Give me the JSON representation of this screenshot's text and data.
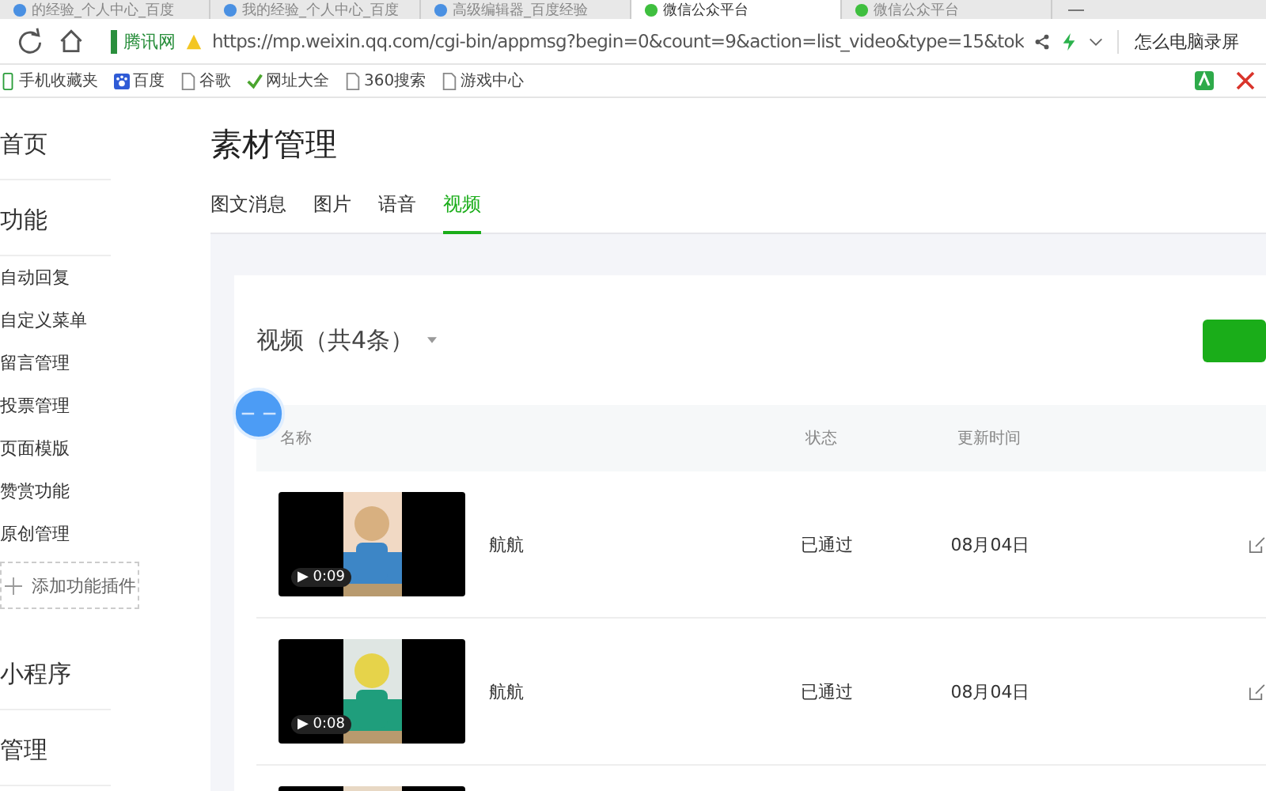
{
  "browser": {
    "tabs": [
      {
        "title": "的经验_个人中心_百度",
        "selected": false
      },
      {
        "title": "我的经验_个人中心_百度",
        "selected": false
      },
      {
        "title": "高级编辑器_百度经验",
        "selected": false
      },
      {
        "title": "微信公众平台",
        "selected": true
      },
      {
        "title": "微信公众平台",
        "selected": false
      }
    ],
    "site_badge": "腾讯网",
    "url": "https://mp.weixin.qq.com/cgi-bin/appmsg?begin=0&count=9&action=list_video&type=15&tok",
    "search": "怎么电脑录屏",
    "bookmarks": [
      {
        "label": "手机收藏夹",
        "kind": "phone"
      },
      {
        "label": "百度",
        "kind": "paw"
      },
      {
        "label": "谷歌",
        "kind": "page"
      },
      {
        "label": "网址大全",
        "kind": "check"
      },
      {
        "label": "360搜索",
        "kind": "page"
      },
      {
        "label": "游戏中心",
        "kind": "page"
      }
    ]
  },
  "sidebar": {
    "items": [
      {
        "label": "首页",
        "kind": "heading"
      },
      {
        "label": "功能",
        "kind": "heading"
      },
      {
        "label": "自动回复",
        "kind": "item"
      },
      {
        "label": "自定义菜单",
        "kind": "item"
      },
      {
        "label": "留言管理",
        "kind": "item"
      },
      {
        "label": "投票管理",
        "kind": "item"
      },
      {
        "label": "页面模版",
        "kind": "item"
      },
      {
        "label": "赞赏功能",
        "kind": "item"
      },
      {
        "label": "原创管理",
        "kind": "item"
      },
      {
        "label": "添加功能插件",
        "kind": "add"
      },
      {
        "label": "小程序",
        "kind": "heading"
      },
      {
        "label": "管理",
        "kind": "heading"
      }
    ]
  },
  "page": {
    "title": "素材管理",
    "tabs": [
      {
        "label": "图文消息",
        "selected": false
      },
      {
        "label": "图片",
        "selected": false
      },
      {
        "label": "语音",
        "selected": false
      },
      {
        "label": "视频",
        "selected": true
      }
    ],
    "list": {
      "title": "视频（共4条）",
      "columns": [
        "名称",
        "状态",
        "更新时间"
      ],
      "rows": [
        {
          "kind": "video",
          "duration": "▶ 0:09",
          "name": "航航",
          "status": "已通过",
          "date": "08月04日"
        },
        {
          "kind": "video",
          "duration": "▶ 0:08",
          "name": "航航",
          "status": "已通过",
          "date": "08月04日"
        },
        {
          "kind": "cut"
        }
      ]
    }
  }
}
